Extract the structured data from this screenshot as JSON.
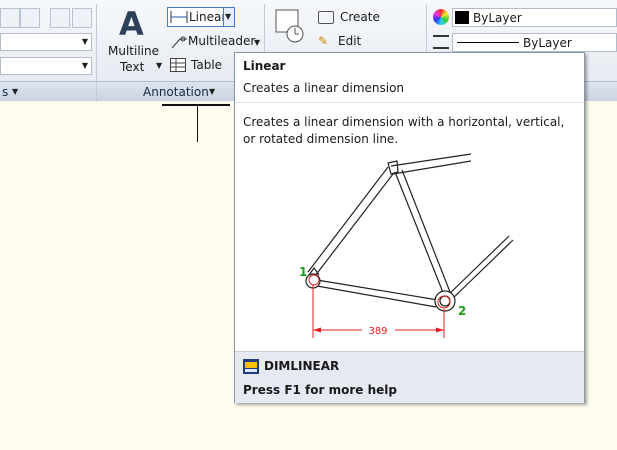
{
  "ribbon": {
    "multiline_text": {
      "line1": "Multiline",
      "line2": "Text"
    },
    "linear_label": "Linear",
    "multileader_label": "Multileader",
    "table_label": "Table",
    "create_label": "Create",
    "edit_label": "Edit",
    "annotation_panel": "Annotation",
    "color_value": "ByLayer",
    "linetype_value": "ByLayer"
  },
  "tooltip": {
    "title": "Linear",
    "subtitle": "Creates a linear dimension",
    "description": "Creates a linear dimension with a horizontal, vertical, or rotated dimension line.",
    "illustration": {
      "point1": "1",
      "point2": "2",
      "dimension_value": "389"
    },
    "command": "DIMLINEAR",
    "help": "Press F1 for more help"
  },
  "colors": {
    "accent": "#e02020",
    "green_label": "#1aa01a",
    "canvas": "#fdfcef"
  }
}
